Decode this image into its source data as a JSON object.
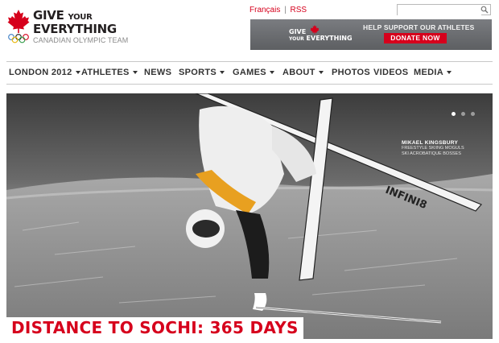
{
  "header": {
    "logo": {
      "line1_a": "GIVE",
      "line1_b": "YOUR",
      "line2": "EVERYTHING",
      "line3": "CANADIAN OLYMPIC TEAM"
    },
    "top_links": {
      "francais": "Français",
      "separator": "|",
      "rss": "RSS"
    },
    "search": {
      "placeholder": "",
      "icon": "search-icon"
    },
    "banner": {
      "mark_line1": "GIVE",
      "mark_line2": "YOUR",
      "mark_line3": "EVERYTHING",
      "help_text": "HELP SUPPORT OUR ATHLETES",
      "donate_label": "DONATE NOW"
    }
  },
  "nav": {
    "items": [
      {
        "label": "LONDON 2012",
        "dropdown": true
      },
      {
        "label": "ATHLETES",
        "dropdown": true
      },
      {
        "label": "NEWS",
        "dropdown": false
      },
      {
        "label": "SPORTS",
        "dropdown": true
      },
      {
        "label": "GAMES",
        "dropdown": true
      },
      {
        "label": "ABOUT",
        "dropdown": true
      },
      {
        "label": "PHOTOS",
        "dropdown": false
      },
      {
        "label": "VIDEOS",
        "dropdown": false
      },
      {
        "label": "MEDIA",
        "dropdown": true
      }
    ]
  },
  "hero": {
    "athlete_name": "MIKAEL KINGSBURY",
    "athlete_discipline_en": "FREESTYLE SKIING MOGULS",
    "athlete_discipline_fr": "SKI ACROBATIQUE BOSSES",
    "ski_text": "INFINI8",
    "countdown": "DISTANCE TO SOCHI: 365 DAYS",
    "slides": {
      "count": 3,
      "active": 1
    }
  },
  "colors": {
    "brand_red": "#d6001c",
    "nav_text": "#333333",
    "banner_grey": "#6b6d70"
  }
}
